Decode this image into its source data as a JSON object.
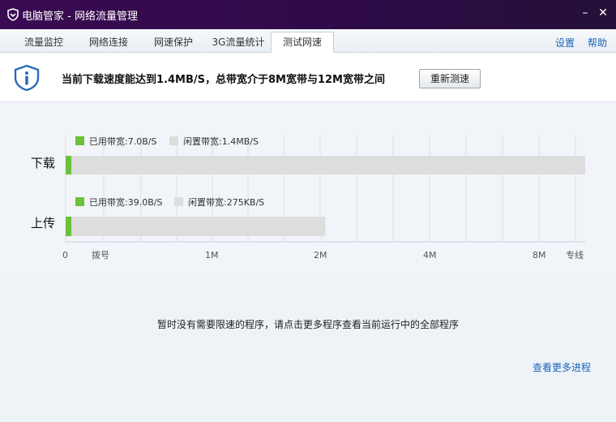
{
  "window": {
    "title": "电脑管家 - 网络流量管理",
    "min_icon": "minimize-icon",
    "close_icon": "close-icon"
  },
  "tabs": [
    {
      "label": "流量监控"
    },
    {
      "label": "网络连接"
    },
    {
      "label": "网速保护"
    },
    {
      "label": "3G流量统计"
    },
    {
      "label": "测试网速",
      "active": true
    }
  ],
  "links": {
    "settings": "设置",
    "help": "帮助"
  },
  "info": {
    "icon": "shield-info-icon",
    "message": "当前下载速度能达到1.4MB/S，总带宽介于8M宽带与12M宽带之间",
    "retest_label": "重新测速"
  },
  "chart_data": {
    "type": "bar",
    "rows": [
      {
        "label": "下载",
        "used_label": "已用带宽:7.0B/S",
        "idle_label": "闲置带宽:1.4MB/S",
        "used_fraction": 0.01,
        "total_fraction": 1.0
      },
      {
        "label": "上传",
        "used_label": "已用带宽:39.0B/S",
        "idle_label": "闲置带宽:275KB/S",
        "used_fraction": 0.02,
        "total_fraction": 0.5
      }
    ],
    "axis_ticks": [
      "0",
      "拨号",
      "1M",
      "2M",
      "4M",
      "8M",
      "专线"
    ],
    "colors": {
      "used": "#6cc13a",
      "idle": "#dddddd"
    }
  },
  "bottom": {
    "note": "暂时没有需要限速的程序，请点击更多程序查看当前运行中的全部程序",
    "more_link": "查看更多进程"
  }
}
